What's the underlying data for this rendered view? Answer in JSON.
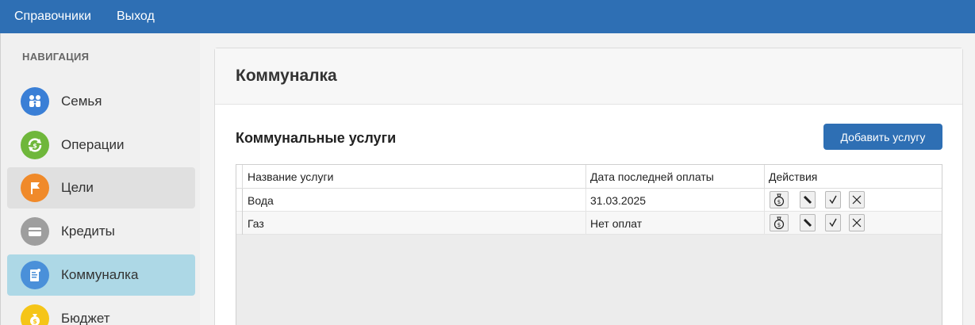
{
  "topbar": {
    "items": [
      "Справочники",
      "Выход"
    ]
  },
  "sidebar": {
    "heading": "НАВИГАЦИЯ",
    "items": [
      {
        "label": "Семья",
        "icon": "family-icon",
        "color": "#3a7fd6"
      },
      {
        "label": "Операции",
        "icon": "operations-icon",
        "color": "#6fb73b"
      },
      {
        "label": "Цели",
        "icon": "flag-icon",
        "color": "#f08a2a"
      },
      {
        "label": "Кредиты",
        "icon": "card-icon",
        "color": "#9e9e9e"
      },
      {
        "label": "Коммуналка",
        "icon": "receipt-icon",
        "color": "#4a90d9"
      },
      {
        "label": "Бюджет",
        "icon": "money-bag-icon",
        "color": "#f5c518"
      }
    ],
    "active_index": 4,
    "hover_index": 2
  },
  "page": {
    "title": "Коммуналка",
    "section_title": "Коммунальные услуги",
    "add_button": "Добавить услугу"
  },
  "table": {
    "columns": [
      "Название услуги",
      "Дата последней оплаты",
      "Действия"
    ],
    "rows": [
      {
        "name": "Вода",
        "last_payment": "31.03.2025"
      },
      {
        "name": "Газ",
        "last_payment": "Нет оплат"
      }
    ],
    "actions": [
      "pay-icon",
      "edit-icon",
      "check-icon",
      "delete-icon"
    ]
  },
  "colors": {
    "accent": "#2e6fb4",
    "active_nav": "#add8e6"
  }
}
